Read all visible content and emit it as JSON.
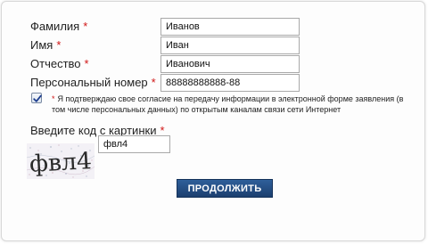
{
  "form": {
    "required_mark": "*",
    "fields": [
      {
        "label": "Фамилия",
        "value": "Иванов"
      },
      {
        "label": "Имя",
        "value": "Иван"
      },
      {
        "label": "Отчество",
        "value": "Иванович"
      },
      {
        "label": "Персональный номер",
        "value": "88888888888-88"
      }
    ],
    "consent": {
      "checked": true,
      "text": "Я подтверждаю свое согласие на передачу информации в электронной форме заявления (в том числе персональных данных) по открытым каналам связи сети Интернет"
    },
    "captcha": {
      "label": "Введите код с картинки",
      "image_text": "фвл4",
      "value": "фвл4"
    },
    "submit_label": "ПРОДОЛЖИТЬ"
  },
  "colors": {
    "required": "#d01515",
    "button": "#1f4577",
    "button_text": "#ffffff"
  }
}
